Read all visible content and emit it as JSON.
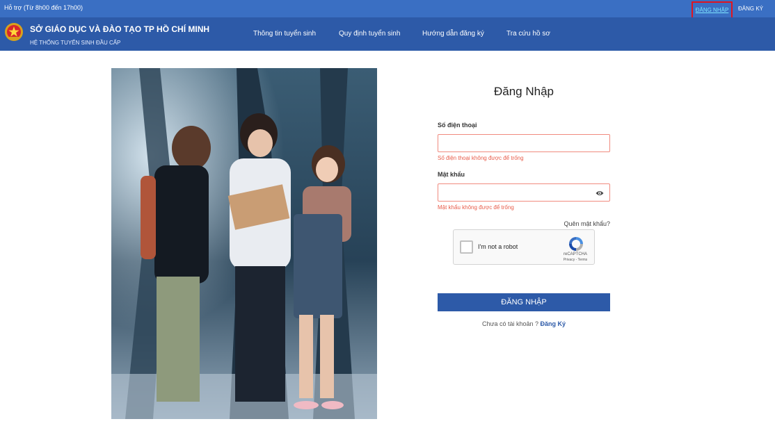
{
  "topbar": {
    "support_text": "Hỗ trợ (Từ 8h00 đến 17h00)",
    "login_label": "ĐĂNG NHẬP",
    "register_label": "ĐĂNG KÝ"
  },
  "header": {
    "org_name": "SỞ GIÁO DỤC VÀ ĐÀO TẠO TP HỒ CHÍ MINH",
    "org_subtitle": "HỆ THỐNG TUYỂN SINH ĐẦU CẤP",
    "nav": [
      {
        "label": "Thông tin tuyển sinh"
      },
      {
        "label": "Quy định tuyển sinh"
      },
      {
        "label": "Hướng dẫn đăng ký"
      },
      {
        "label": "Tra cứu hồ sơ"
      }
    ]
  },
  "form": {
    "title": "Đăng Nhập",
    "phone_label": "Số điện thoại",
    "phone_value": "",
    "phone_error": "Số điện thoại không được để trống",
    "password_label": "Mật khẩu",
    "password_value": "",
    "password_error": "Mật khẩu không được để trống",
    "forgot_label": "Quên mật khẩu?",
    "submit_label": "ĐĂNG NHẬP",
    "no_account_text": "Chưa có tài khoản ? ",
    "signup_link": "Đăng Ký"
  },
  "captcha": {
    "label": "I'm not a robot",
    "brand": "reCAPTCHA",
    "terms": "Privacy - Terms"
  },
  "colors": {
    "topbar": "#3a6fc3",
    "header": "#2d5aa8",
    "error": "#e85c4a",
    "highlight": "#e0141e"
  },
  "icons": {
    "emblem": "national-emblem-icon",
    "eye": "eye-icon",
    "recaptcha": "recaptcha-logo-icon"
  }
}
